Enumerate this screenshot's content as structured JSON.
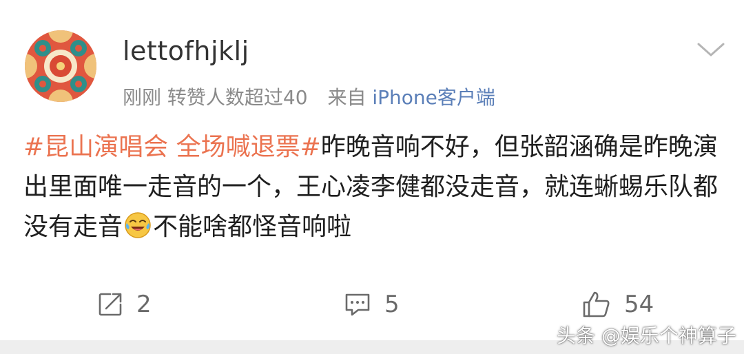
{
  "post": {
    "username": "lettofhjklj",
    "time": "刚刚",
    "forward_note": "转赞人数超过40",
    "source_prefix": "来自",
    "source": "iPhone客户端",
    "topic": "#昆山演唱会 全场喊退票#",
    "body_part1": "昨晚音响不好，但张韶涵确是昨晚演出里面唯一走音的一个，王心凌李健都没走音，就连蜥蜴乐队都没有走音",
    "emoji_name": "laugh-cry-emoji",
    "body_part2": "不能啥都怪音响啦"
  },
  "actions": {
    "repost_count": "2",
    "comment_count": "5",
    "like_count": "54"
  },
  "watermark": "头条 @娱乐个神算子",
  "colors": {
    "topic": "#eb7350",
    "source_link": "#5b7fb8",
    "meta_gray": "#8a8a8a"
  }
}
